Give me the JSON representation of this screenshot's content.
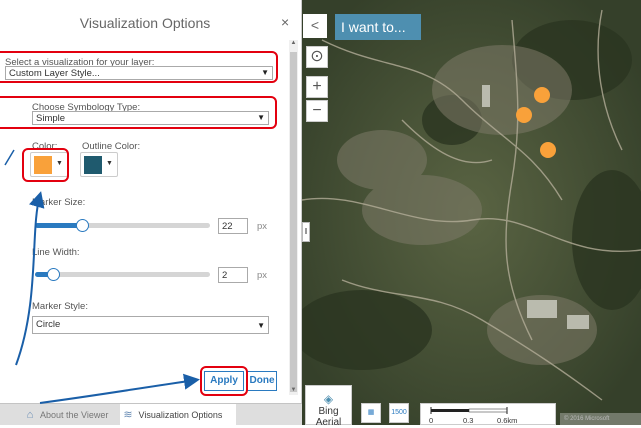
{
  "panel": {
    "title": "Visualization Options",
    "close_icon": "×",
    "visualization": {
      "label": "Select a visualization for your layer:",
      "value": "Custom Layer Style..."
    },
    "symbology": {
      "label": "Choose Symbology Type:",
      "value": "Simple"
    },
    "color": {
      "label": "Color:",
      "value": "#f9a13a"
    },
    "outline_color": {
      "label": "Outline Color:",
      "value": "#1f5a6e"
    },
    "marker_size": {
      "label": "Marker Size:",
      "value": "22",
      "unit": "px",
      "fraction": 0.27
    },
    "line_width": {
      "label": "Line Width:",
      "value": "2",
      "unit": "px",
      "fraction": 0.1
    },
    "marker_style": {
      "label": "Marker Style:",
      "value": "Circle"
    },
    "apply_label": "Apply",
    "done_label": "Done"
  },
  "tabs": [
    {
      "label": "About the Viewer",
      "icon": "home-icon"
    },
    {
      "label": "Visualization Options",
      "icon": "layers-icon"
    }
  ],
  "map": {
    "collapse_icon": "<",
    "i_want_to": "I want to...",
    "zoom_in": "+",
    "zoom_out": "−",
    "basemap_label": "Bing Aerial",
    "scale_button": "1500",
    "scale_ticks": [
      "0",
      "0.3",
      "0.6km"
    ],
    "attribution": "© 2016 Microsoft Corporation"
  },
  "colors": {
    "accent": "#2a7ac0",
    "highlight": "#e3000f",
    "marker": "#f9a13a",
    "header_blue": "#4e8fb0"
  }
}
